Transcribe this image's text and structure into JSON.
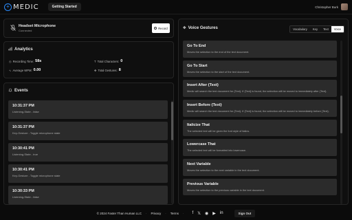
{
  "app": {
    "logo_text": "MEDIC",
    "nav_button": "Getting Started",
    "user_name": "Christopher Burk"
  },
  "mic": {
    "title": "Headset Microphone",
    "status": "Connected",
    "record_label": "Record"
  },
  "analytics": {
    "title": "Analytics",
    "recording_time_label": "Recording Time:",
    "recording_time": "58s",
    "total_characters_label": "Total Characters:",
    "total_characters": "0",
    "average_wpm_label": "Average WPM:",
    "average_wpm": "0.00",
    "total_gestures_label": "Total Gestures:",
    "total_gestures": "8"
  },
  "events": {
    "title": "Events",
    "items": [
      {
        "time": "10:31:37 PM",
        "desc": "Listening-State - false"
      },
      {
        "time": "10:31:37 PM",
        "desc": "Key-Gesture - Toggle microphone state"
      },
      {
        "time": "10:30:41 PM",
        "desc": "Listening-State - true"
      },
      {
        "time": "10:30:41 PM",
        "desc": "Key-Gesture - Toggle microphone state"
      },
      {
        "time": "10:30:33 PM",
        "desc": "Listening-State - false"
      }
    ]
  },
  "voice": {
    "title": "Voice Gestures",
    "tabs": [
      "Vocabulary",
      "Key",
      "Text",
      "Voice"
    ],
    "active_tab": "Voice",
    "gestures": [
      {
        "name": "Go To End",
        "desc": "Moves the selection to the end of the text document."
      },
      {
        "name": "Go To Start",
        "desc": "Moves the selection to the start of the text document."
      },
      {
        "name": "Insert After {Text}",
        "desc": "Medic will search the text document for {Text}. If {Text} is found, the selection will be moved to immediately after {Text}."
      },
      {
        "name": "Insert Before {Text}",
        "desc": "Medic will search the text document for {Text}. If {Text} is found, the selection will be moved to immediately before {Text}."
      },
      {
        "name": "Italicize That",
        "desc": "The selected text will be given the font style of italics."
      },
      {
        "name": "Lowercase That",
        "desc": "The selected text will be formatted into lowercase."
      },
      {
        "name": "Next Variable",
        "desc": "Moves the selection to the next variable in the text document."
      },
      {
        "name": "Previous Variable",
        "desc": "Moves the selection to the previous variable in the text document."
      }
    ]
  },
  "footer": {
    "copyright": "© 2024 Faster Than Human LLC",
    "privacy": "Privacy",
    "terms": "Terms",
    "sign_out": "Sign Out"
  },
  "colors": {
    "accent": "#2a8cff",
    "card": "#2b2b2b",
    "background": "#0b0b0b"
  }
}
